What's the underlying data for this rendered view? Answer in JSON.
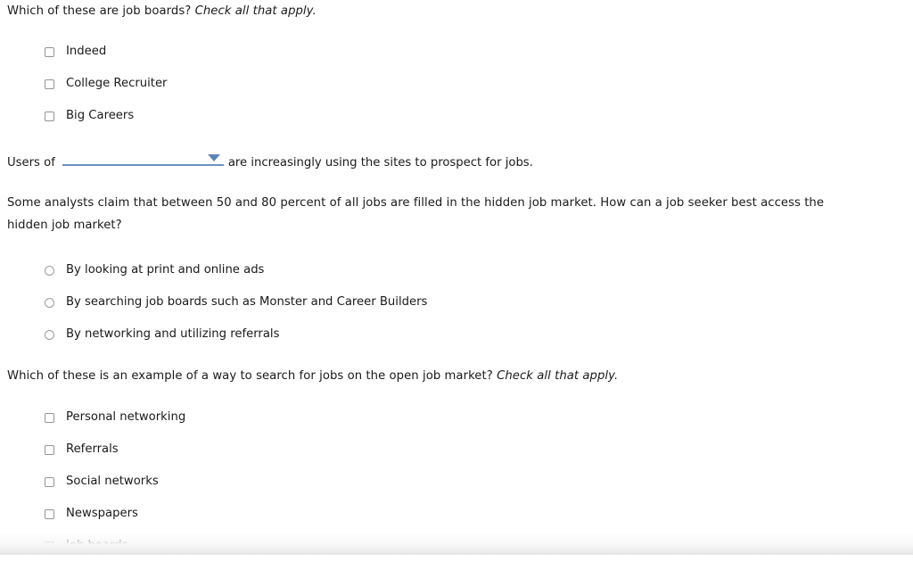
{
  "questions": [
    {
      "id": "q1",
      "type": "checkbox",
      "prompt": "Which of these are job boards?",
      "prompt_emphasis": "Check all that apply.",
      "options": [
        {
          "label": "Indeed",
          "checked": false
        },
        {
          "label": "College Recruiter",
          "checked": false
        },
        {
          "label": "Big Careers",
          "checked": false
        }
      ]
    },
    {
      "id": "q2",
      "type": "fill-in-dropdown",
      "lead_text": "Users of",
      "trail_text": "are increasingly using the sites to prospect for jobs.",
      "dropdown": {
        "selected": "",
        "placeholder": "",
        "caret_icon": "chevron-down-icon",
        "accent_color": "#6a93c0"
      }
    },
    {
      "id": "q3",
      "type": "radio",
      "prompt": "Some analysts claim that between 50 and 80 percent of all jobs are filled in the hidden job market. How can a job seeker best access the hidden job market?",
      "prompt_emphasis": "",
      "options": [
        {
          "label": "By looking at print and online ads",
          "selected": false
        },
        {
          "label": "By searching job boards such as Monster and Career Builders",
          "selected": false
        },
        {
          "label": "By networking and utilizing referrals",
          "selected": false
        }
      ]
    },
    {
      "id": "q4",
      "type": "checkbox",
      "prompt": "Which of these is an example of a way to search for jobs on the open job market?",
      "prompt_emphasis": "Check all that apply.",
      "options": [
        {
          "label": "Personal networking",
          "checked": false
        },
        {
          "label": "Referrals",
          "checked": false
        },
        {
          "label": "Social networks",
          "checked": false
        },
        {
          "label": "Newspapers",
          "checked": false
        },
        {
          "label": "Job boards",
          "checked": false
        }
      ]
    }
  ],
  "colors": {
    "text": "#1a1a1a",
    "background": "#ffffff",
    "dropdown_accent": "#6a93c0",
    "control_border": "#949494"
  }
}
